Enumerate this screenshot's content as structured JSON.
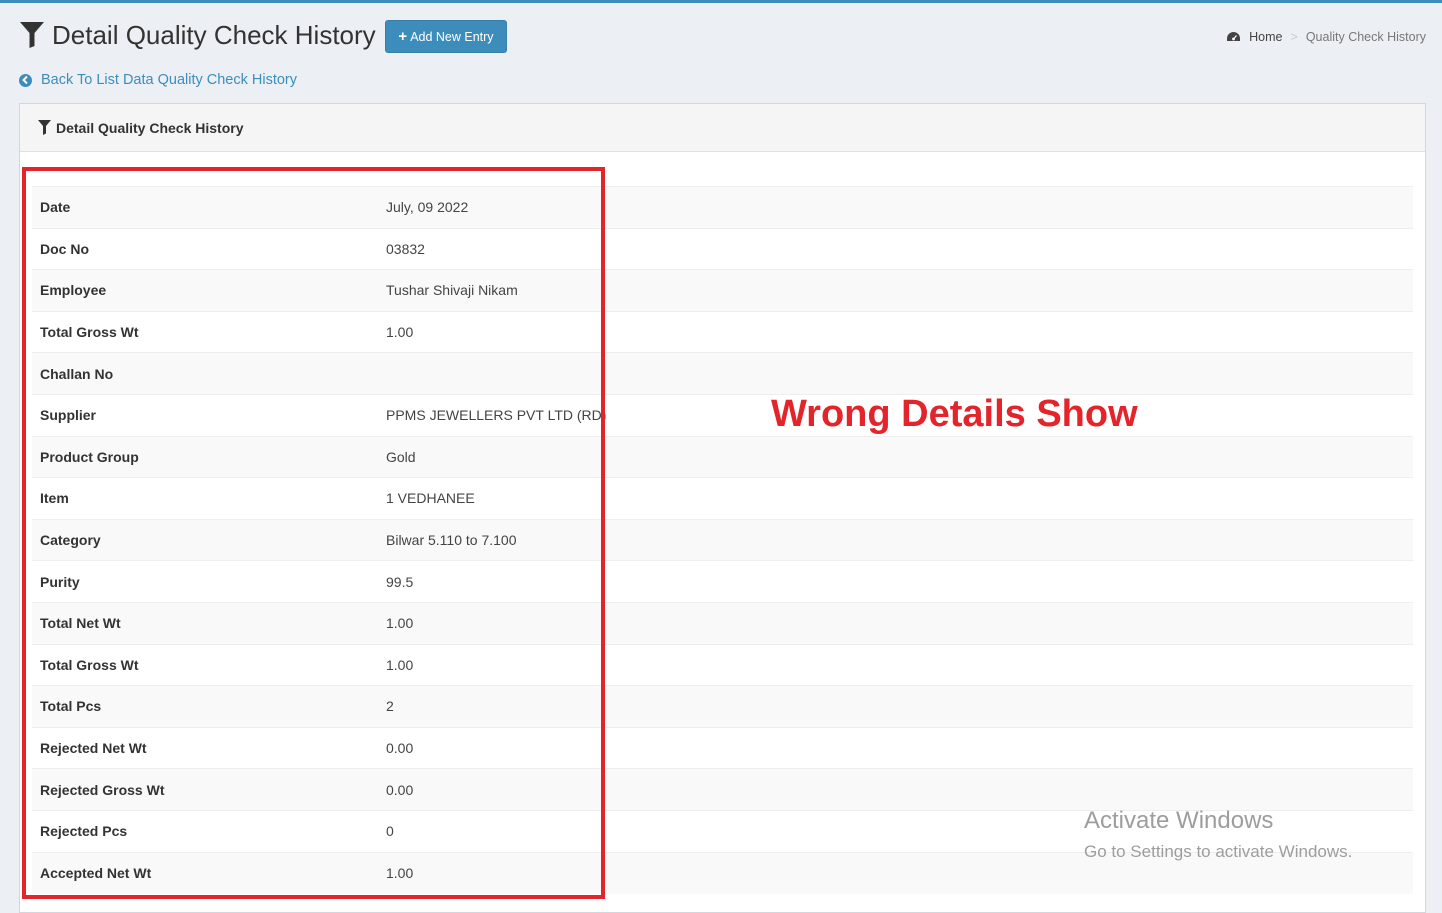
{
  "header": {
    "title": "Detail Quality Check History",
    "add_button_label": "Add New Entry",
    "breadcrumb": {
      "home": "Home",
      "current": "Quality Check History"
    },
    "back_link": "Back To List Data Quality Check History"
  },
  "panel": {
    "title": "Detail Quality Check History"
  },
  "details": [
    {
      "label": "Date",
      "value": "July, 09 2022"
    },
    {
      "label": "Doc No",
      "value": "03832"
    },
    {
      "label": "Employee",
      "value": "Tushar Shivaji Nikam"
    },
    {
      "label": "Total Gross Wt",
      "value": "1.00"
    },
    {
      "label": "Challan No",
      "value": ""
    },
    {
      "label": "Supplier",
      "value": "PPMS JEWELLERS PVT LTD (RD)"
    },
    {
      "label": "Product Group",
      "value": "Gold"
    },
    {
      "label": "Item",
      "value": "1 VEDHANEE"
    },
    {
      "label": "Category",
      "value": "Bilwar 5.110 to 7.100"
    },
    {
      "label": "Purity",
      "value": "99.5"
    },
    {
      "label": "Total Net Wt",
      "value": "1.00"
    },
    {
      "label": "Total Gross Wt",
      "value": "1.00"
    },
    {
      "label": "Total Pcs",
      "value": "2"
    },
    {
      "label": "Rejected Net Wt",
      "value": "0.00"
    },
    {
      "label": "Rejected Gross Wt",
      "value": "0.00"
    },
    {
      "label": "Rejected Pcs",
      "value": "0"
    },
    {
      "label": "Accepted Net Wt",
      "value": "1.00"
    }
  ],
  "annotation": {
    "text": "Wrong Details Show",
    "color": "#e3242b"
  },
  "watermark": {
    "line1": "Activate Windows",
    "line2": "Go to Settings to activate Windows."
  },
  "colors": {
    "primary": "#3c8dbc",
    "background": "#ecf0f5"
  },
  "icons": {
    "title": "filter-icon",
    "home": "dashboard-icon",
    "back": "chevron-circle-left-icon"
  }
}
